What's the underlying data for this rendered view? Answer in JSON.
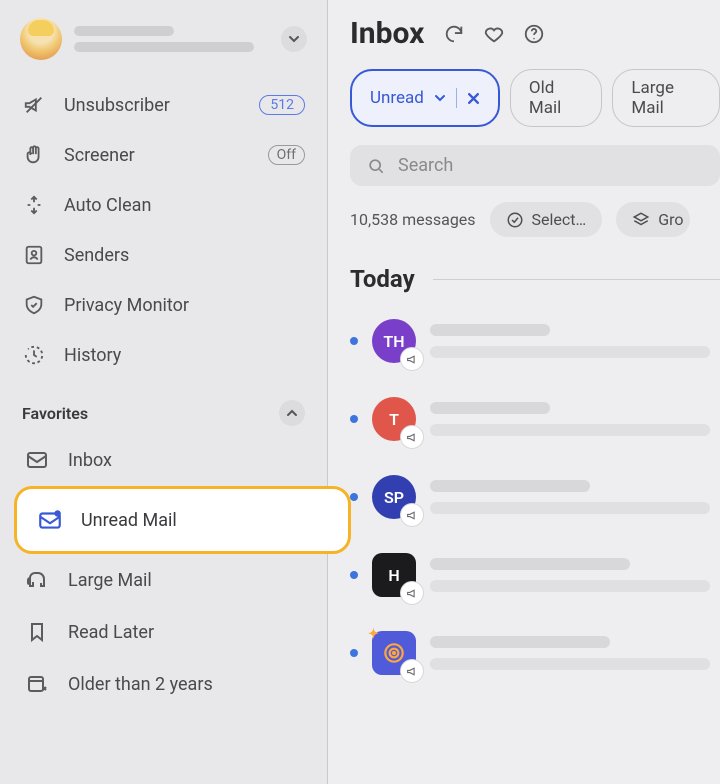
{
  "user": {
    "name": "",
    "email": ""
  },
  "sidebar": {
    "items": [
      {
        "id": "unsubscriber",
        "label": "Unsubscriber",
        "badge": "512"
      },
      {
        "id": "screener",
        "label": "Screener",
        "badge": "Off"
      },
      {
        "id": "autoclean",
        "label": "Auto Clean"
      },
      {
        "id": "senders",
        "label": "Senders"
      },
      {
        "id": "privacy",
        "label": "Privacy Monitor"
      },
      {
        "id": "history",
        "label": "History"
      }
    ]
  },
  "favorites": {
    "title": "Favorites",
    "items": [
      {
        "id": "inbox",
        "label": "Inbox"
      },
      {
        "id": "unread",
        "label": "Unread Mail",
        "active": true
      },
      {
        "id": "large",
        "label": "Large Mail"
      },
      {
        "id": "later",
        "label": "Read Later"
      },
      {
        "id": "older",
        "label": "Older than 2 years"
      }
    ]
  },
  "main": {
    "title": "Inbox",
    "filters": [
      {
        "id": "unread",
        "label": "Unread",
        "active": true
      },
      {
        "id": "old",
        "label": "Old Mail"
      },
      {
        "id": "large",
        "label": "Large Mail"
      }
    ],
    "search_placeholder": "Search",
    "message_count": "10,538 messages",
    "select_label": "Select…",
    "group_label": "Gro",
    "section_label": "Today",
    "messages": [
      {
        "initials": "TH",
        "color": "#7a3fc9"
      },
      {
        "initials": "T",
        "color": "#e0564b"
      },
      {
        "initials": "SP",
        "color": "#323fb0"
      },
      {
        "initials": "H",
        "color": "#1b1b1d",
        "square": true
      },
      {
        "initials": "",
        "color": "#4f5bd8",
        "square": true,
        "swirl": true
      }
    ]
  }
}
